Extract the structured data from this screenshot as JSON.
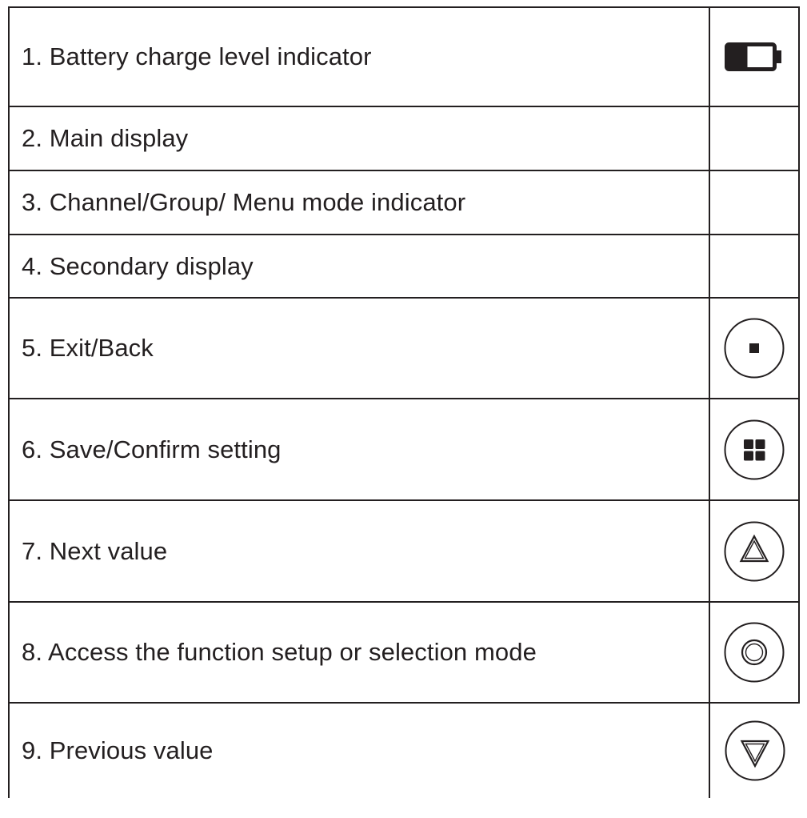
{
  "legend": {
    "rows": [
      {
        "label": "1. Battery charge level indicator",
        "icon": "battery-icon"
      },
      {
        "label": "2. Main display",
        "icon": ""
      },
      {
        "label": "3. Channel/Group/ Menu mode indicator",
        "icon": ""
      },
      {
        "label": "4. Secondary display",
        "icon": ""
      },
      {
        "label": "5. Exit/Back",
        "icon": "exit-back-button-icon"
      },
      {
        "label": "6. Save/Confirm setting",
        "icon": "save-confirm-button-icon"
      },
      {
        "label": "7. Next value",
        "icon": "next-value-button-icon"
      },
      {
        "label": "8. Access the function setup or selection mode",
        "icon": "function-setup-button-icon"
      },
      {
        "label": "9. Previous value",
        "icon": "previous-value-button-icon"
      }
    ]
  },
  "colors": {
    "ink": "#231f20",
    "background": "#ffffff"
  }
}
